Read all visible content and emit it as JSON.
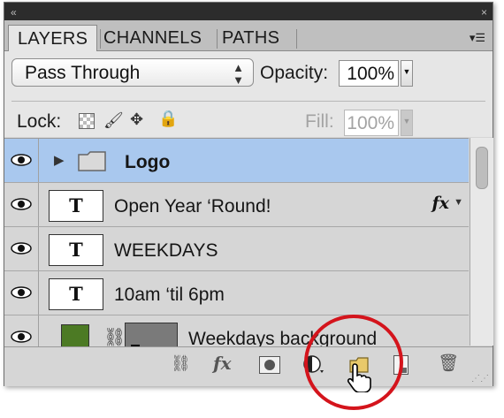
{
  "tabs": [
    {
      "label": "LAYERS",
      "active": true
    },
    {
      "label": "CHANNELS",
      "active": false
    },
    {
      "label": "PATHS",
      "active": false
    }
  ],
  "titlebar": {
    "collapse_glyph": "«",
    "close_glyph": "×"
  },
  "panel_menu_icon": "panel-menu-icon",
  "blend_mode": "Pass Through",
  "opacity": {
    "label": "Opacity:",
    "value": "100%"
  },
  "lock": {
    "label": "Lock:"
  },
  "fill": {
    "label": "Fill:",
    "value": "100%"
  },
  "layers": [
    {
      "name": "Logo",
      "kind": "group",
      "selected": true
    },
    {
      "name": "Open Year ‘Round!",
      "kind": "text",
      "fx": "fx"
    },
    {
      "name": "WEEKDAYS",
      "kind": "text"
    },
    {
      "name": "10am ‘til 6pm",
      "kind": "text"
    },
    {
      "name": "Weekdays background",
      "kind": "shape",
      "color": "#4c7a24"
    }
  ],
  "text_thumb_glyph": "T",
  "toolbar_fx": "fx",
  "colors": {
    "selected_row": "#a9c8ee",
    "highlight_circle": "#d4141c"
  }
}
